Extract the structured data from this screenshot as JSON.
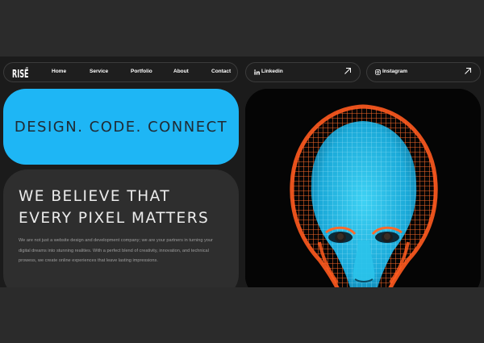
{
  "brand": {
    "logo_text": "RISE",
    "mark": "®"
  },
  "nav": {
    "items": [
      {
        "label": "Home"
      },
      {
        "label": "Service"
      },
      {
        "label": "Portfolio"
      },
      {
        "label": "About"
      },
      {
        "label": "Contact"
      }
    ]
  },
  "social": {
    "linkedin": {
      "label": "Linkedin",
      "icon": "linkedin-icon"
    },
    "instagram": {
      "label": "Instagram",
      "icon": "instagram-icon"
    }
  },
  "hero": {
    "tagline": "DESIGN. CODE. CONNECT",
    "headline_line1": "WE BELIEVE THAT",
    "headline_line2": "EVERY PIXEL MATTERS",
    "body": "We are not just a website design and development company; we are your partners in turning your digital dreams into stunning realities. With a perfect blend of creativity, innovation, and technical prowess, we create online experiences that leave lasting impressions."
  },
  "colors": {
    "accent": "#1eb6f5",
    "face_cyan": "#1fb3e0",
    "wire_orange": "#ff5a1f",
    "page_bg": "#1b1b1b"
  }
}
